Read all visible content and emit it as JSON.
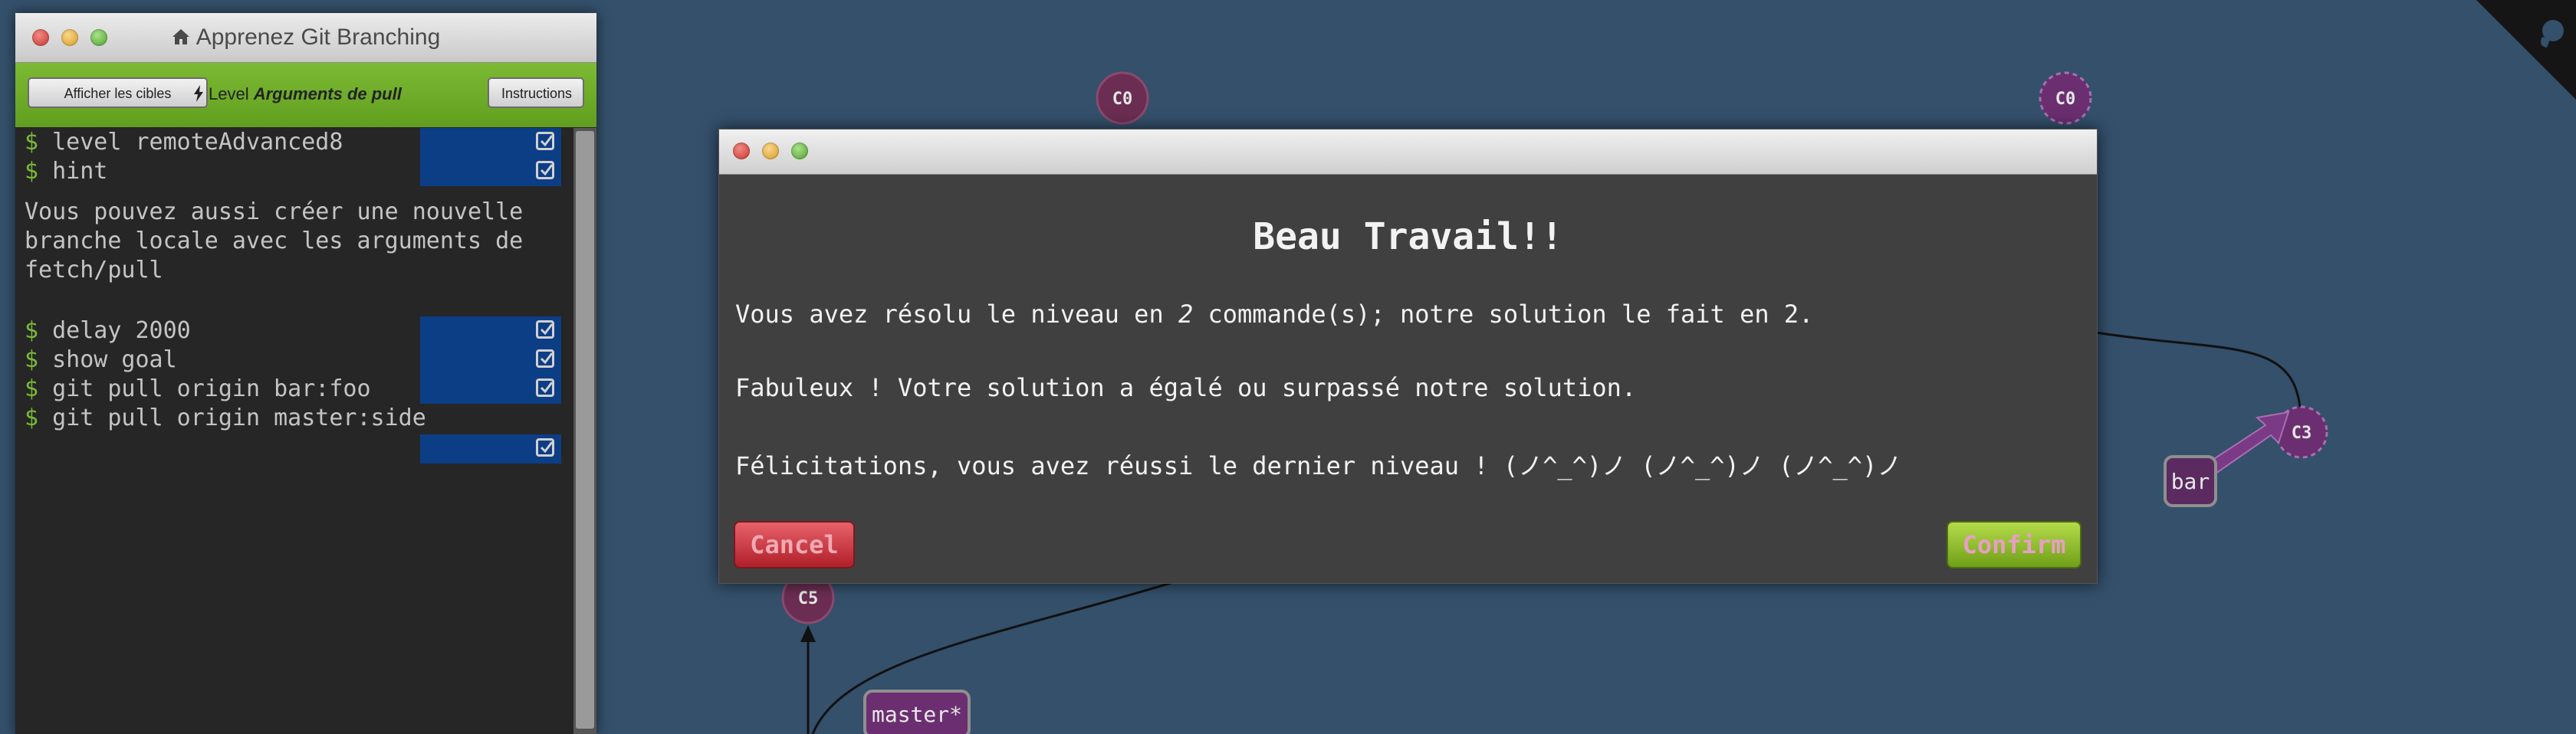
{
  "window": {
    "title": "Apprenez Git Branching"
  },
  "toolbar": {
    "goals_label": "Afficher les cibles",
    "level_prefix": "Level",
    "level_name": "Arguments de pull",
    "instructions_label": "Instructions"
  },
  "terminal": {
    "prompt": "$",
    "commands": [
      "level remoteAdvanced8",
      "hint",
      "delay 2000",
      "show goal",
      "git pull origin bar:foo",
      "git pull origin master:side"
    ],
    "hint_text": "Vous pouvez aussi créer une nouvelle branche locale avec les arguments de fetch/pull"
  },
  "graph": {
    "commits": [
      "C0",
      "C0",
      "C3",
      "C5"
    ],
    "branches": [
      "bar",
      "master*"
    ]
  },
  "modal": {
    "title": "Beau Travail!!",
    "line1_before": "Vous avez résolu le niveau en ",
    "line1_count": "2",
    "line1_after": " commande(s); notre solution le fait en 2.",
    "line2": "Fabuleux ! Votre solution a égalé ou surpassé notre solution.",
    "line3": "Félicitations, vous avez réussi le dernier niveau ! (ノ^_^)ノ (ノ^_^)ノ (ノ^_^)ノ",
    "cancel_label": "Cancel",
    "confirm_label": "Confirm"
  },
  "colors": {
    "background": "#34506b",
    "toolbar_green": "#6fac2a",
    "commit_purple": "#6b2e70",
    "modal_bg": "#404040"
  }
}
